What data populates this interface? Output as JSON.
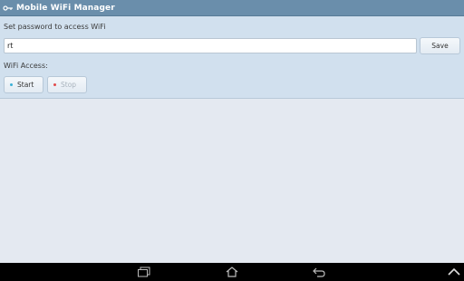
{
  "app": {
    "title": "Mobile WiFi Manager"
  },
  "password": {
    "label": "Set password to access WiFi",
    "value": "rt",
    "save_label": "Save"
  },
  "access": {
    "label": "WiFi Access:",
    "start_label": "Start",
    "stop_label": "Stop",
    "start_dot_color": "#3bb0d6",
    "stop_dot_color": "#e14a4a"
  },
  "colors": {
    "titlebar": "#6a8eab",
    "panel": "#d1e0ee",
    "background": "#e4e9f1"
  },
  "navbar": {
    "icons": [
      "recent-apps-icon",
      "home-icon",
      "back-icon",
      "chevron-up-icon"
    ]
  }
}
